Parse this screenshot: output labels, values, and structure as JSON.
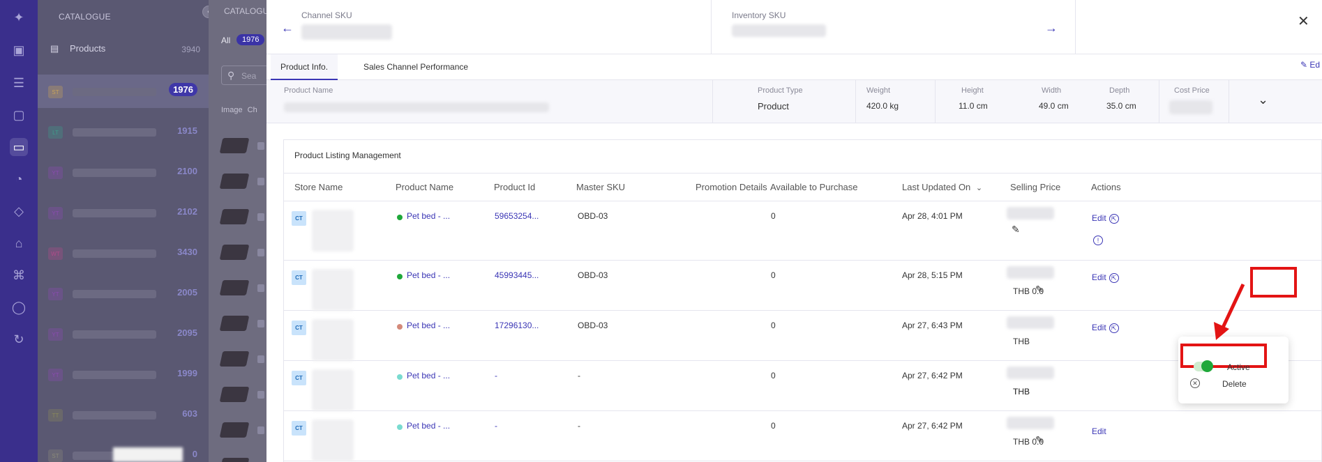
{
  "catalogue": {
    "title": "CATALOGUE",
    "products_label": "Products",
    "products_count": "3940",
    "rows": [
      {
        "badge": "ST",
        "count": "1976",
        "selected": true,
        "color": "#c8a35a"
      },
      {
        "badge": "LT",
        "count": "1915",
        "selected": false,
        "color": "#3d9c8a"
      },
      {
        "badge": "YT",
        "count": "2100",
        "selected": false,
        "color": "#8a4bb0"
      },
      {
        "badge": "YT",
        "count": "2102",
        "selected": false,
        "color": "#8a4bb0"
      },
      {
        "badge": "WT",
        "count": "3430",
        "selected": false,
        "color": "#b04b8a"
      },
      {
        "badge": "YT",
        "count": "2005",
        "selected": false,
        "color": "#8a4bb0"
      },
      {
        "badge": "YT",
        "count": "2095",
        "selected": false,
        "color": "#8a4bb0"
      },
      {
        "badge": "YT",
        "count": "1999",
        "selected": false,
        "color": "#8a4bb0"
      },
      {
        "badge": "TT",
        "count": "603",
        "selected": false,
        "color": "#8a8a5a"
      },
      {
        "badge": "ST",
        "count": "0",
        "selected": false,
        "color": "#8a8a7a"
      }
    ]
  },
  "catalogue_list": {
    "title": "CATALOGUE",
    "all_label": "All",
    "all_count": "1976",
    "search_placeholder": "Sea",
    "col_image": "Image",
    "col_ch": "Ch"
  },
  "sku_bar": {
    "channel_sku_label": "Channel SKU",
    "inventory_sku_label": "Inventory SKU"
  },
  "tabs": {
    "product_info": "Product Info.",
    "sales_channel": "Sales Channel Performance",
    "edit": "Ed"
  },
  "product_info": {
    "name_label": "Product Name",
    "type_label": "Product Type",
    "type_value": "Product",
    "weight_label": "Weight",
    "weight_value": "420.0 kg",
    "height_label": "Height",
    "height_value": "11.0 cm",
    "width_label": "Width",
    "width_value": "49.0 cm",
    "depth_label": "Depth",
    "depth_value": "35.0 cm",
    "cost_label": "Cost Price"
  },
  "listing": {
    "title": "Product Listing Management",
    "columns": {
      "store": "Store Name",
      "product": "Product Name",
      "product_id": "Product Id",
      "master_sku": "Master SKU",
      "promotion": "Promotion Details",
      "available": "Available to Purchase",
      "updated": "Last Updated On",
      "price": "Selling Price",
      "actions": "Actions"
    },
    "rows": [
      {
        "store": "CT",
        "product": "Pet bed - ...",
        "product_id": "59653254...",
        "master_sku": "OBD-03",
        "available": "0",
        "updated": "Apr 28, 4:01 PM",
        "price": "",
        "edit": "Edit",
        "status_color": "#1fa83a"
      },
      {
        "store": "CT",
        "product": "Pet bed - ...",
        "product_id": "45993445...",
        "master_sku": "OBD-03",
        "available": "0",
        "updated": "Apr 28, 5:15 PM",
        "price": "THB 0.0",
        "edit": "Edit",
        "status_color": "#1fa83a"
      },
      {
        "store": "CT",
        "product": "Pet bed - ...",
        "product_id": "17296130...",
        "master_sku": "OBD-03",
        "available": "0",
        "updated": "Apr 27, 6:43 PM",
        "price": "THB",
        "edit": "Edit",
        "status_color": "#d48a7a"
      },
      {
        "store": "CT",
        "product": "Pet bed - ...",
        "product_id": "-",
        "master_sku": "-",
        "available": "0",
        "updated": "Apr 27, 6:42 PM",
        "price": "THB",
        "price2": "THB",
        "edit": "",
        "status_color": "#7adbd0"
      },
      {
        "store": "CT",
        "product": "Pet bed - ...",
        "product_id": "-",
        "master_sku": "-",
        "available": "0",
        "updated": "Apr 27, 6:42 PM",
        "price": "THB 0.0",
        "edit": "Edit",
        "status_color": "#7adbd0"
      }
    ]
  },
  "menu": {
    "active_label": "Active",
    "delete_label": "Delete"
  }
}
